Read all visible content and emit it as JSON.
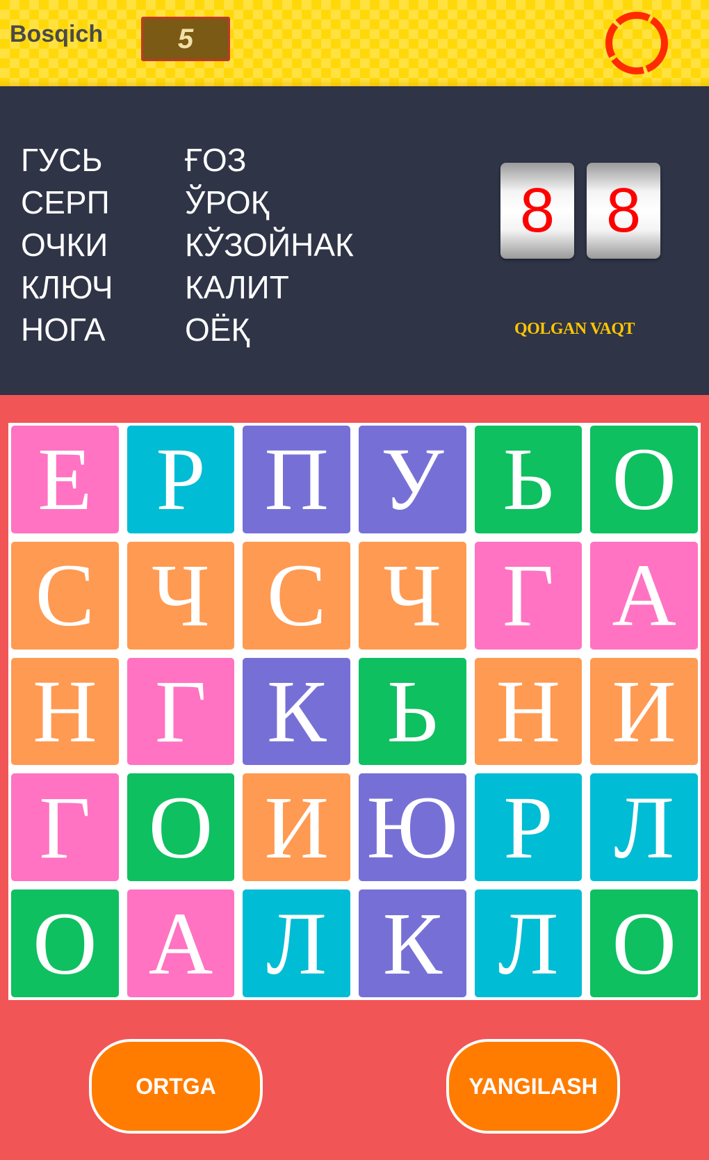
{
  "header": {
    "level_label": "Bosqich",
    "level_value": "5"
  },
  "words": {
    "left": [
      "ГУСЬ",
      "СЕРП",
      "ОЧКИ",
      "КЛЮЧ",
      "НОГА"
    ],
    "right": [
      "ҒОЗ",
      "ЎРОҚ",
      "КЎЗОЙНАК",
      "КАЛИТ",
      "ОЁҚ"
    ]
  },
  "timer": {
    "digits": [
      "8",
      "8"
    ],
    "label": "QOLGAN VAQT"
  },
  "colors": {
    "pink": "#ff73c2",
    "cyan": "#00bcd4",
    "purple": "#7670d6",
    "green": "#0ec060",
    "orange": "#ff9a52"
  },
  "grid": [
    [
      {
        "l": "Е",
        "c": "pink"
      },
      {
        "l": "Р",
        "c": "cyan"
      },
      {
        "l": "П",
        "c": "purple"
      },
      {
        "l": "У",
        "c": "purple"
      },
      {
        "l": "Ь",
        "c": "green"
      },
      {
        "l": "О",
        "c": "green"
      }
    ],
    [
      {
        "l": "С",
        "c": "orange"
      },
      {
        "l": "Ч",
        "c": "orange"
      },
      {
        "l": "С",
        "c": "orange"
      },
      {
        "l": "Ч",
        "c": "orange"
      },
      {
        "l": "Г",
        "c": "pink"
      },
      {
        "l": "А",
        "c": "pink"
      }
    ],
    [
      {
        "l": "Н",
        "c": "orange"
      },
      {
        "l": "Г",
        "c": "pink"
      },
      {
        "l": "К",
        "c": "purple"
      },
      {
        "l": "Ь",
        "c": "green"
      },
      {
        "l": "Н",
        "c": "orange"
      },
      {
        "l": "И",
        "c": "orange"
      }
    ],
    [
      {
        "l": "Г",
        "c": "pink"
      },
      {
        "l": "О",
        "c": "green"
      },
      {
        "l": "И",
        "c": "orange"
      },
      {
        "l": "Ю",
        "c": "purple"
      },
      {
        "l": "Р",
        "c": "cyan"
      },
      {
        "l": "Л",
        "c": "cyan"
      }
    ],
    [
      {
        "l": "О",
        "c": "green"
      },
      {
        "l": "А",
        "c": "pink"
      },
      {
        "l": "Л",
        "c": "cyan"
      },
      {
        "l": "К",
        "c": "purple"
      },
      {
        "l": "Л",
        "c": "cyan"
      },
      {
        "l": "О",
        "c": "green"
      }
    ]
  ],
  "buttons": {
    "back_label": "ORTGA",
    "refresh_label": "YANGILASH"
  }
}
